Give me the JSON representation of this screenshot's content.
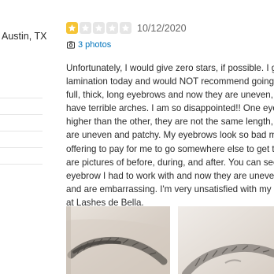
{
  "reviewer": {
    "location": "Austin, TX"
  },
  "review": {
    "rating": 1,
    "max_rating": 5,
    "star_color": "#f5c436",
    "date": "10/12/2020",
    "photos_link": "3 photos",
    "photos_icon": "camera-icon",
    "text_lines": [
      "Unfortunately, I would give zero stars, if possible. I g",
      "lamination today and would NOT recommend going",
      "full, thick, long eyebrows and now they are uneven, c",
      "have terrible arches. I am so disappointed!! One eyel",
      "higher than the other, they are not the same length,",
      "are uneven and patchy. My eyebrows look so bad my",
      "offering to pay for me to go somewhere else to get t",
      "are pictures of before, during, and after. You can see",
      "eyebrow I had to work with and now they are unever",
      "and are embarrassing. I'm very unsatisfied with my e",
      "at Lashes de Bella."
    ]
  }
}
